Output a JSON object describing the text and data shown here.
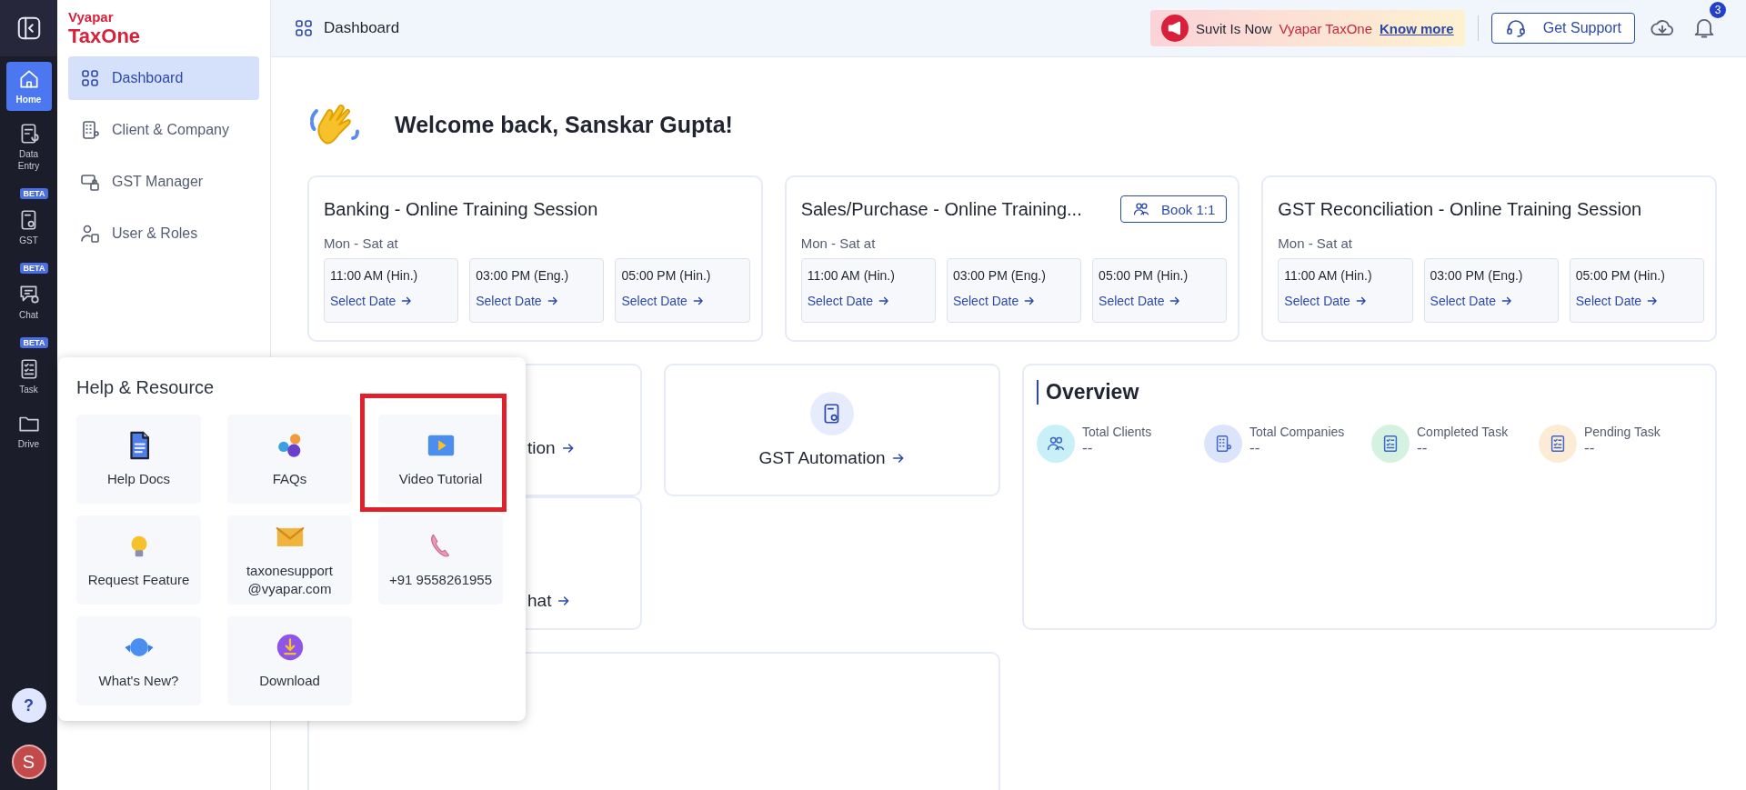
{
  "rail": {
    "items": [
      {
        "label": "Home",
        "selected": true
      },
      {
        "label": "Data Entry",
        "selected": false
      },
      {
        "label": "GST",
        "selected": false,
        "badge": "BETA"
      },
      {
        "label": "Chat",
        "selected": false,
        "badge": "BETA"
      },
      {
        "label": "Task",
        "selected": false,
        "badge": "BETA"
      },
      {
        "label": "Drive",
        "selected": false
      }
    ],
    "help_button": {
      "label": "?",
      "selected": true
    },
    "avatar": {
      "initial": "S"
    }
  },
  "sidebar": {
    "logo": {
      "line1": "Vyapar",
      "line2": "TaxOne"
    },
    "items": [
      {
        "label": "Dashboard",
        "selected": true
      },
      {
        "label": "Client & Company",
        "selected": false
      },
      {
        "label": "GST Manager",
        "selected": false
      },
      {
        "label": "User & Roles",
        "selected": false
      }
    ]
  },
  "header": {
    "title": "Dashboard",
    "announcement": {
      "text": "Suvit Is Now",
      "brand": "Vyapar TaxOne",
      "link": "Know more"
    },
    "support_button": "Get Support",
    "notification_count": "3"
  },
  "welcome": "Welcome back, Sanskar Gupta!",
  "training_sessions": [
    {
      "title": "Banking - Online Training Session",
      "schedule": "Mon - Sat at",
      "slots": [
        {
          "time": "11:00 AM (Hin.)",
          "link": "Select Date"
        },
        {
          "time": "03:00 PM (Eng.)",
          "link": "Select Date"
        },
        {
          "time": "05:00 PM (Hin.)",
          "link": "Select Date"
        }
      ]
    },
    {
      "title": "Sales/Purchase - Online Training...",
      "action": "Book 1:1",
      "schedule": "Mon - Sat at",
      "slots": [
        {
          "time": "11:00 AM (Hin.)",
          "link": "Select Date"
        },
        {
          "time": "03:00 PM (Eng.)",
          "link": "Select Date"
        },
        {
          "time": "05:00 PM (Hin.)",
          "link": "Select Date"
        }
      ]
    },
    {
      "title": "GST Reconciliation - Online Training Session",
      "schedule": "Mon - Sat at",
      "slots": [
        {
          "time": "11:00 AM (Hin.)",
          "link": "Select Date"
        },
        {
          "time": "03:00 PM (Eng.)",
          "link": "Select Date"
        },
        {
          "time": "05:00 PM (Hin.)",
          "link": "Select Date"
        }
      ]
    }
  ],
  "shortcuts": [
    {
      "label": "tion",
      "kind": "covered"
    },
    {
      "label": "GST Automation",
      "kind": "icon"
    },
    {
      "label": "hat",
      "kind": "covered"
    }
  ],
  "overview": {
    "title": "Overview",
    "stats": [
      {
        "label": "Total Clients",
        "value": "--",
        "color": "#c9f0f7"
      },
      {
        "label": "Total Companies",
        "value": "--",
        "color": "#dbe4fb"
      },
      {
        "label": "Completed Task",
        "value": "--",
        "color": "#d5f2e1"
      },
      {
        "label": "Pending Task",
        "value": "--",
        "color": "#fdecd5"
      }
    ]
  },
  "help_popup": {
    "title": "Help & Resource",
    "items": [
      {
        "lines": [
          "Help Docs"
        ],
        "highlighted": false
      },
      {
        "lines": [
          "FAQs"
        ],
        "highlighted": false
      },
      {
        "lines": [
          "Video Tutorial"
        ],
        "highlighted": true
      },
      {
        "lines": [
          "Request Feature"
        ],
        "highlighted": false
      },
      {
        "lines": [
          "taxonesupport",
          "@vyapar.com"
        ],
        "highlighted": false
      },
      {
        "lines": [
          "+91 9558261955"
        ],
        "highlighted": false
      },
      {
        "lines": [
          "What's New?"
        ],
        "highlighted": false
      },
      {
        "lines": [
          "Download"
        ],
        "highlighted": false
      }
    ]
  }
}
